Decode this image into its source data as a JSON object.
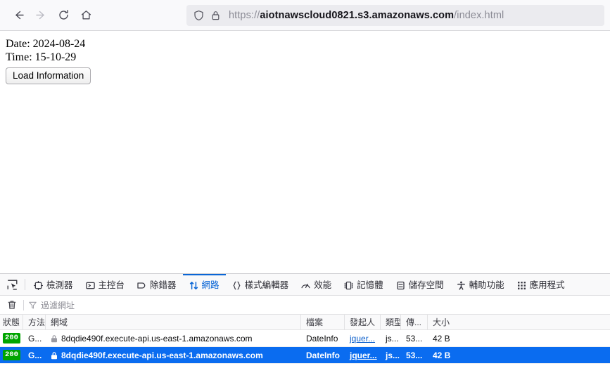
{
  "browser": {
    "nav": {
      "back_label": "Back",
      "forward_label": "Forward",
      "reload_label": "Reload",
      "home_label": "Home"
    },
    "url": {
      "protocol": "https://",
      "host": "aiotnawscloud0821.s3.amazonaws.com",
      "path": "/index.html",
      "full": "https://aiotnawscloud0821.s3.amazonaws.com/index.html"
    }
  },
  "page": {
    "date_line": "Date: 2024-08-24",
    "time_line": "Time: 15-10-29",
    "load_button": "Load Information"
  },
  "devtools": {
    "tabs": [
      {
        "label": "檢測器",
        "icon": "inspector-icon",
        "active": false
      },
      {
        "label": "主控台",
        "icon": "console-icon",
        "active": false
      },
      {
        "label": "除錯器",
        "icon": "debugger-icon",
        "active": false
      },
      {
        "label": "網路",
        "icon": "network-icon",
        "active": true
      },
      {
        "label": "樣式編輯器",
        "icon": "style-editor-icon",
        "active": false
      },
      {
        "label": "效能",
        "icon": "performance-icon",
        "active": false
      },
      {
        "label": "記憶體",
        "icon": "memory-icon",
        "active": false
      },
      {
        "label": "儲存空間",
        "icon": "storage-icon",
        "active": false
      },
      {
        "label": "輔助功能",
        "icon": "accessibility-icon",
        "active": false
      },
      {
        "label": "應用程式",
        "icon": "application-icon",
        "active": false
      }
    ],
    "toolbar": {
      "clear_label": "清除",
      "filter_placeholder": "過濾網址"
    },
    "table": {
      "columns": [
        {
          "key": "status",
          "label": "狀態"
        },
        {
          "key": "method",
          "label": "方法"
        },
        {
          "key": "domain",
          "label": "網域"
        },
        {
          "key": "file",
          "label": "檔案"
        },
        {
          "key": "initiator",
          "label": "發起人"
        },
        {
          "key": "type",
          "label": "類型"
        },
        {
          "key": "transferred",
          "label": "傳..."
        },
        {
          "key": "size",
          "label": "大小"
        }
      ],
      "rows": [
        {
          "status": "200",
          "method": "G...",
          "domain": "8dqdie490f.execute-api.us-east-1.amazonaws.com",
          "file": "DateInfo",
          "initiator": "jquer...",
          "type": "js...",
          "transferred": "53...",
          "size": "42 B",
          "selected": false
        },
        {
          "status": "200",
          "method": "G...",
          "domain": "8dqdie490f.execute-api.us-east-1.amazonaws.com",
          "file": "DateInfo",
          "initiator": "jquer...",
          "type": "js...",
          "transferred": "53...",
          "size": "42 B",
          "selected": true
        }
      ]
    }
  },
  "colors": {
    "accent_blue": "#0a66d6",
    "selection_blue": "#0a6cf0",
    "status_green": "#00a500"
  }
}
